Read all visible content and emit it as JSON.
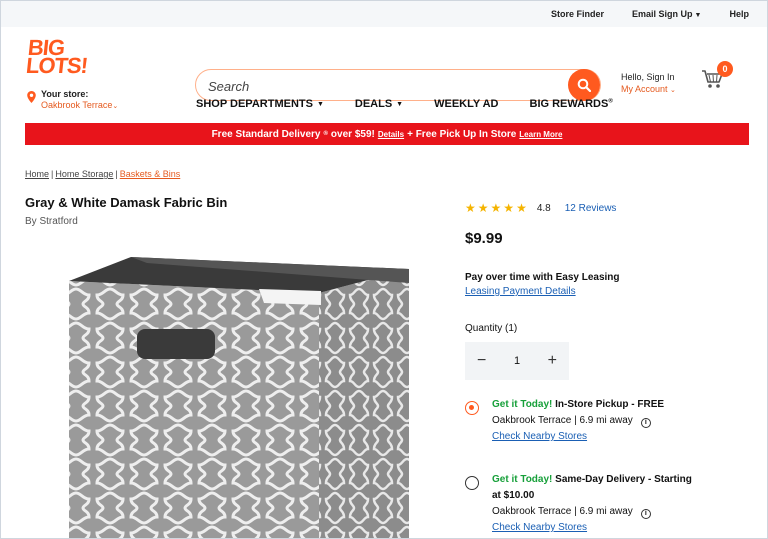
{
  "utility": {
    "store_finder": "Store Finder",
    "email_signup": "Email Sign Up",
    "help": "Help"
  },
  "header": {
    "logo_line1": "BIG",
    "logo_line2": "LOTS!",
    "store_label": "Your store:",
    "store_name": "Oakbrook Terrace",
    "search_placeholder": "Search",
    "account_hello": "Hello, Sign In",
    "account_link": "My Account",
    "cart_count": "0"
  },
  "nav": {
    "items": [
      "SHOP DEPARTMENTS",
      "DEALS",
      "WEEKLY AD",
      "BIG REWARDS"
    ],
    "registered_mark": "®"
  },
  "promo": {
    "text1": "Free Standard Delivery",
    "text2": " over $59! ",
    "details": "Details",
    "text3": " + Free Pick Up In Store ",
    "learn_more": "Learn More"
  },
  "breadcrumb": [
    "Home",
    "Home Storage",
    "Baskets & Bins"
  ],
  "product": {
    "title": "Gray & White Damask Fabric Bin",
    "brand": "By Stratford",
    "rating": "4.8",
    "reviews": "12 Reviews",
    "stars_filled": 5,
    "price": "$9.99",
    "lease_title": "Pay over time with Easy Leasing",
    "lease_link": "Leasing Payment Details",
    "quantity_label": "Quantity (1)",
    "quantity_value": "1"
  },
  "fulfillment": [
    {
      "highlight": "Get it Today!",
      "title": " In-Store Pickup - FREE",
      "store": "Oakbrook Terrace | 6.9 mi away",
      "link": "Check Nearby Stores",
      "selected": true
    },
    {
      "highlight": "Get it Today!",
      "title": " Same-Day Delivery - Starting",
      "title2": "at $10.00",
      "store": "Oakbrook Terrace | 6.9 mi away",
      "link": "Check Nearby Stores",
      "selected": false
    }
  ],
  "colors": {
    "brand_orange": "#ff5a1f",
    "promo_red": "#e8141b",
    "link_blue": "#1a5fb4",
    "green": "#17a03a",
    "star": "#f5b400"
  }
}
